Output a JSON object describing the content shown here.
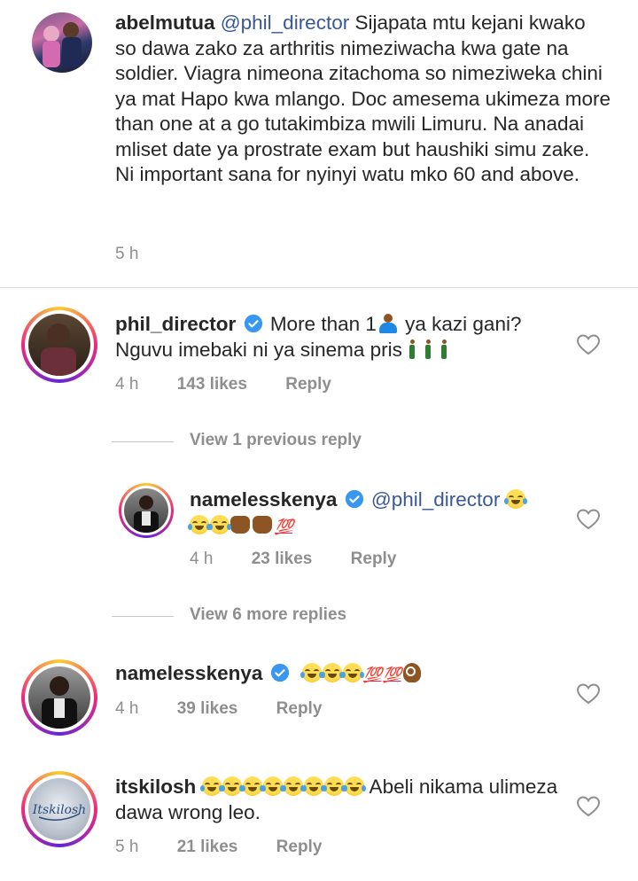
{
  "comments": [
    {
      "username": "abelmutua",
      "mention": "@phil_director",
      "text": " Sijapata mtu kejani kwako so dawa zako za arthritis nimeziwacha kwa gate na soldier. Viagra nimeona zitachoma so nimeziweka chini ya mat Hapo kwa mlango. Doc amesema ukimeza more than one at a go tutakimbiza mwili Limuru. Na anadai mliset date ya prostrate exam but haushiki simu zake. Ni important sana for nyinyi watu mko 60 and above.",
      "time": "5 h"
    },
    {
      "username": "phil_director",
      "text_a": "More than 1",
      "text_b": " ya kazi gani? Nguvu imebaki ni ya sinema pris",
      "time": "4 h",
      "likes": "143 likes",
      "reply": "Reply"
    },
    {
      "view_replies": "View 1 previous reply"
    },
    {
      "username": "namelesskenya",
      "mention": "@phil_director",
      "hundred": "💯",
      "time": "4 h",
      "likes": "23 likes",
      "reply": "Reply"
    },
    {
      "view_replies": "View 6 more replies"
    },
    {
      "username": "namelesskenya",
      "hundred_a": "💯",
      "hundred_b": "💯",
      "time": "4 h",
      "likes": "39 likes",
      "reply": "Reply"
    },
    {
      "username": "itskilosh",
      "text": " Abeli nikama ulimeza dawa wrong leo.",
      "time": "5 h",
      "likes": "21 likes",
      "reply": "Reply",
      "avatar_logo": "Itskilosh"
    }
  ],
  "icons": {
    "like": "heart-outline",
    "verified": "verified-badge",
    "colors": {
      "verified": "#3897f0",
      "ring_start": "#f9ce34",
      "ring_end": "#6228d7"
    }
  }
}
